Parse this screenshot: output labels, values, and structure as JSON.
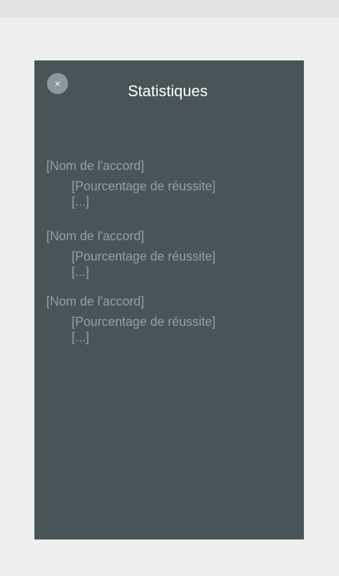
{
  "header": {
    "close_label": "×",
    "title": "Statistiques"
  },
  "stats": [
    {
      "name": "[Nom de l'accord]",
      "percent": "[Pourcentage de réussite]",
      "more": "[...]"
    },
    {
      "name": "[Nom de l'accord]",
      "percent": "[Pourcentage de réussite]",
      "more": "[...]"
    },
    {
      "name": "[Nom de l'accord]",
      "percent": "[Pourcentage de réussite]",
      "more": "[...]"
    }
  ],
  "colors": {
    "background": "#eeeeee",
    "panel": "#485457",
    "title": "#ffffff",
    "muted_text": "#94a0a3",
    "close_button": "#8c999c"
  }
}
